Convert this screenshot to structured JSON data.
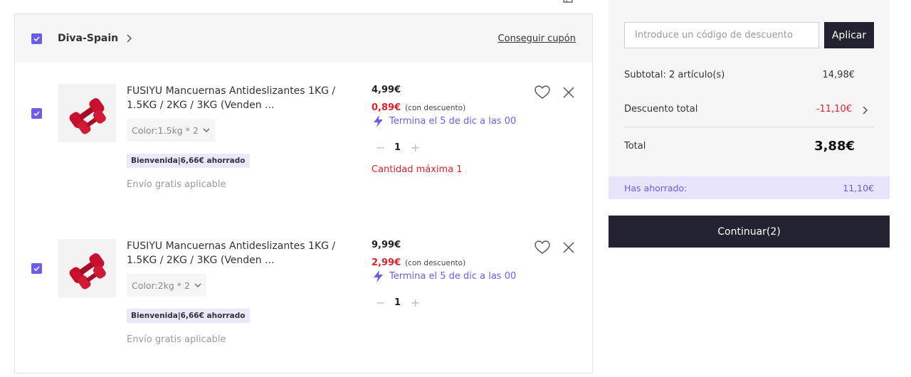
{
  "store": {
    "name": "Diva-Spain",
    "coupon_link": "Conseguir cupón"
  },
  "items": [
    {
      "title": "FUSIYU Mancuernas Antideslizantes 1KG / 1.5KG / 2KG / 3KG (Venden ...",
      "variant": "Color:1.5kg * 2",
      "badge": "Bienvenida|6,66€ ahorrado",
      "shipping": "Envío gratis aplicable",
      "original_price": "4,99€",
      "discount_price": "0,89€",
      "discount_note": "(con descuento)",
      "promo": "Termina el 5 de dic a las 00",
      "quantity": "1",
      "minus": "−",
      "plus": "+",
      "max_qty": "Cantidad máxima 1",
      "image_color": "#c8102e"
    },
    {
      "title": "FUSIYU Mancuernas Antideslizantes 1KG / 1.5KG / 2KG / 3KG (Venden ...",
      "variant": "Color:2kg * 2",
      "badge": "Bienvenida|6,66€ ahorrado",
      "shipping": "Envío gratis aplicable",
      "original_price": "9,99€",
      "discount_price": "2,99€",
      "discount_note": "(con descuento)",
      "promo": "Termina el 5 de dic a las 00",
      "quantity": "1",
      "minus": "−",
      "plus": "+",
      "image_color": "#c8102e"
    }
  ],
  "summary": {
    "coupon_placeholder": "Introduce un código de descuento",
    "apply_label": "Aplicar",
    "subtotal_label": "Subtotal: 2 artículo(s)",
    "subtotal_value": "14,98€",
    "discount_label": "Descuento total",
    "discount_value": "-11,10€",
    "total_label": "Total",
    "total_value": "3,88€",
    "saved_label": "Has ahorrado:",
    "saved_value": "11,10€",
    "continue_label": "Continuar(2)"
  },
  "colors": {
    "accent": "#6b5de8",
    "price_red": "#d9232d",
    "dark_button": "#222230"
  },
  "icons": {
    "checkbox": "checkbox-checked-icon",
    "chevron": "chevron-right-icon",
    "dropdown": "chevron-down-icon",
    "promo": "lightning-icon",
    "wishlist": "heart-icon",
    "remove": "close-icon"
  }
}
